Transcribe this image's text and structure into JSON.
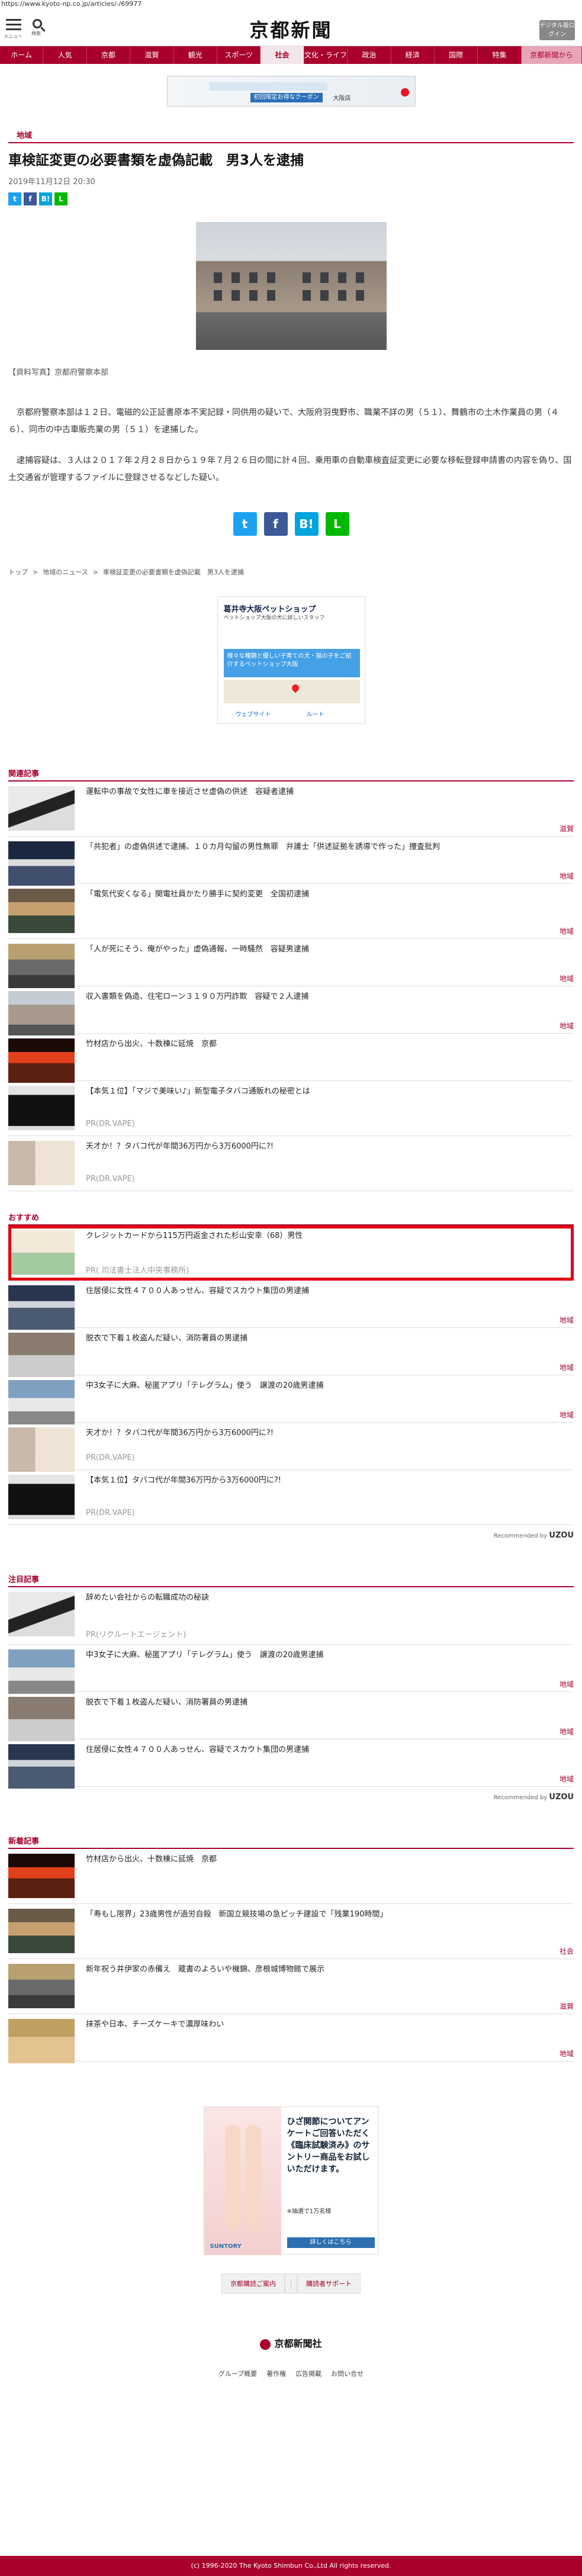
{
  "url": "https://www.kyoto-np.co.jp/articles/-/69977",
  "header": {
    "menu_label": "メニュー",
    "search_label": "検索",
    "logo": "京都新聞",
    "digital_label": "デジタル版ログイン"
  },
  "nav": [
    "ホーム",
    "人気",
    "京都",
    "滋賀",
    "観光",
    "スポーツ",
    "社会",
    "文化・ライフ",
    "政治",
    "経済",
    "国際",
    "特集",
    "京都新聞から"
  ],
  "nav_active": "社会",
  "top_ad": {
    "button": "初回限定お得なクーポン",
    "brand": "大阪店"
  },
  "article": {
    "category": "地域",
    "title": "車検証変更の必要書類を虚偽記載　男3人を逮捕",
    "date": "2019年11月12日 20:30",
    "caption": "【資料写真】京都府警察本部",
    "paragraphs": [
      "京都府警察本部は１２日、電磁的公正証書原本不実記録・同供用の疑いで、大阪府羽曳野市、職業不詳の男（５１）、舞鶴市の土木作業員の男（４６）、同市の中古車販売業の男（５１）を逮捕した。",
      "逮捕容疑は、３人は２０１７年２月２８日から１９年７月２６日の間に計４回、乗用車の自動車検査証変更に必要な移転登録申請書の内容を偽り、国土交通省が管理するファイルに登録させるなどした疑い。"
    ]
  },
  "sns": {
    "tw": "t",
    "fb": "f",
    "hb": "B!",
    "line": "L"
  },
  "breadcrumb": [
    "トップ",
    ">",
    "地域のニュース",
    ">",
    "車検証変更の必要書類を虚偽記載　男3人を逮捕"
  ],
  "mid_ad": {
    "title": "葛井寺大阪ペットショップ",
    "sub": "ペットショップ大阪の犬に詳しいスタッフ",
    "banner": "様々な種類と優しい子育ての犬・猫の子をご紹介するペットショップ大阪",
    "f1": "ウェブサイト",
    "f2": "ルート"
  },
  "related": {
    "heading": "関連記事",
    "items": [
      {
        "text": "運転中の事故で女性に車を接近させ虚偽の供述　容疑者逮捕",
        "sub": "",
        "cat": "滋賀"
      },
      {
        "text": "「共犯者」の虚偽供述で逮捕、１０カ月勾留の男性無罪　弁護士「供述証拠を誘導で作った」捜査批判",
        "sub": "",
        "cat": "地域"
      },
      {
        "text": "「電気代安くなる」関電社員かたり勝手に契約変更　全国初逮捕",
        "sub": "",
        "cat": "地域"
      },
      {
        "text": "「人が死にそう、俺がやった」虚偽通報、一時騒然　容疑男逮捕",
        "sub": "",
        "cat": "地域"
      },
      {
        "text": "収入書類を偽造、住宅ローン３１９０万円詐欺　容疑で２人逮捕",
        "sub": "",
        "cat": "地域"
      },
      {
        "text": "竹材店から出火、十数棟に延焼　京都",
        "sub": "",
        "cat": ""
      },
      {
        "text": "【本気１位】「マジで美味い♪」新型電子タバコ通販れの秘密とは",
        "sub": "PR(DR.VAPE)",
        "cat": ""
      },
      {
        "text": "天才か！？タバコ代が年間36万円から3万6000円に?!",
        "sub": "PR(DR.VAPE)",
        "cat": ""
      }
    ]
  },
  "recommend": {
    "heading": "おすすめ",
    "items": [
      {
        "text": "クレジットカードから115万円返金された杉山安幸（68）男性",
        "sub": "PR( 司法書士法人中央事務所)",
        "cat": ""
      },
      {
        "text": "住居侵に女性４７００人あっせん、容疑でスカウト集団の男逮捕",
        "sub": "",
        "cat": "地域"
      },
      {
        "text": "脱衣で下着１枚盗んだ疑い、消防署員の男逮捕",
        "sub": "",
        "cat": "地域"
      },
      {
        "text": "中3女子に大麻、秘匿アプリ「テレグラム」使う　譲渡の20歳男逮捕",
        "sub": "",
        "cat": "地域"
      },
      {
        "text": "天才か！？タバコ代が年間36万円から3万6000円に?!",
        "sub": "PR(DR.VAPE)",
        "cat": ""
      },
      {
        "text": "【本気１位】タバコ代が年間36万円から3万6000円に?!",
        "sub": "PR(DR.VAPE)",
        "cat": ""
      }
    ],
    "recommended_by": "Recommended by",
    "brand": "UZOU"
  },
  "attention": {
    "heading": "注目記事",
    "items": [
      {
        "text": "辞めたい会社からの転職成功の秘訣",
        "sub": "PR(リクルートエージェント)",
        "cat": ""
      },
      {
        "text": "中3女子に大麻、秘匿アプリ「テレグラム」使う　譲渡の20歳男逮捕",
        "sub": "",
        "cat": "地域"
      },
      {
        "text": "脱衣で下着１枚盗んだ疑い、消防署員の男逮捕",
        "sub": "",
        "cat": "地域"
      },
      {
        "text": "住居侵に女性４７００人あっせん、容疑でスカウト集団の男逮捕",
        "sub": "",
        "cat": "地域"
      }
    ],
    "recommended_by": "Recommended by",
    "brand": "UZOU"
  },
  "latest": {
    "heading": "新着記事",
    "items": [
      {
        "text": "竹材店から出火、十数棟に延焼　京都",
        "sub": "",
        "cat": ""
      },
      {
        "text": "「寿もし限界」23歳男性が過労自殺　新国立競技場の急ピッチ建設で「残業190時間」",
        "sub": "",
        "cat": "社会"
      },
      {
        "text": "新年祝う井伊家の赤備え　蔵書のよろいや機錦、彦根城博物館で展示",
        "sub": "",
        "cat": "滋賀"
      },
      {
        "text": "抹茶や日本、チーズケーキで濃厚味わい",
        "sub": "",
        "cat": "地域"
      }
    ]
  },
  "bottom_ad": {
    "title": "ひざ関節についてアンケートご回答いただく《臨床試験済み》のサントリー商品をお試しいただけます。",
    "sub": "※抽選で1万名様",
    "button": "詳しくはこちら",
    "brand": "SUNTORY"
  },
  "footer": {
    "links": [
      "京都購読ご案内",
      "｜",
      "購読者サポート"
    ],
    "logo": "京都新聞社",
    "flinks": [
      "グループ概要",
      "著作権",
      "広告掲載",
      "お問い合せ"
    ],
    "copyright": "(c) 1996-2020 The Kyoto Shimbun Co.,Ltd All rights reserved."
  }
}
